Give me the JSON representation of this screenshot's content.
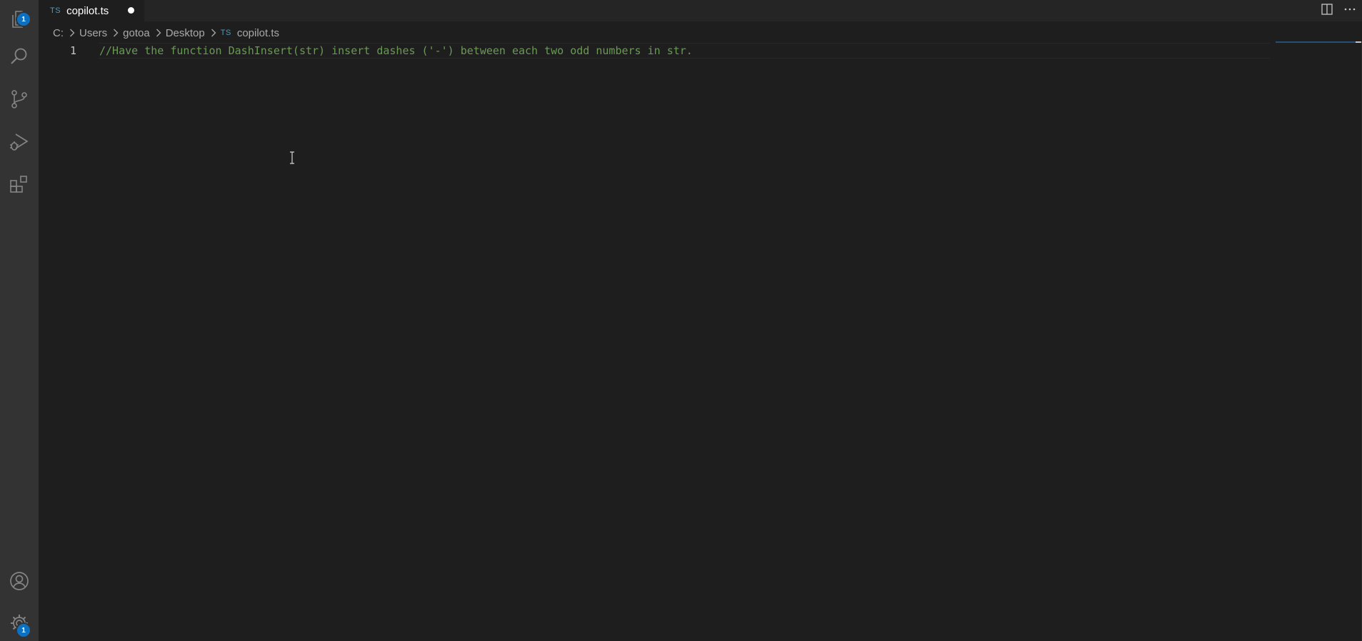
{
  "activity_bar": {
    "items": [
      {
        "name": "explorer",
        "icon": "files-icon",
        "badge": "1"
      },
      {
        "name": "search",
        "icon": "search-icon"
      },
      {
        "name": "source-control",
        "icon": "source-control-icon"
      },
      {
        "name": "run-debug",
        "icon": "run-debug-icon"
      },
      {
        "name": "extensions",
        "icon": "extensions-icon"
      }
    ],
    "bottom": [
      {
        "name": "accounts",
        "icon": "account-icon"
      },
      {
        "name": "manage",
        "icon": "gear-icon",
        "badge": "1"
      }
    ]
  },
  "tab": {
    "lang": "TS",
    "title": "copilot.ts",
    "dirty": true
  },
  "breadcrumb": {
    "items": [
      "C:",
      "Users",
      "gotoa",
      "Desktop"
    ],
    "file_lang": "TS",
    "file": "copilot.ts"
  },
  "editor": {
    "lines": [
      {
        "number": "1",
        "text": "//Have the function DashInsert(str) insert dashes ('-') between each two odd numbers in str."
      }
    ]
  },
  "colors": {
    "background": "#1e1e1e",
    "activity_bar": "#333333",
    "badge": "#0e70c0",
    "comment": "#6a9955",
    "ts_blue": "#519aba"
  }
}
